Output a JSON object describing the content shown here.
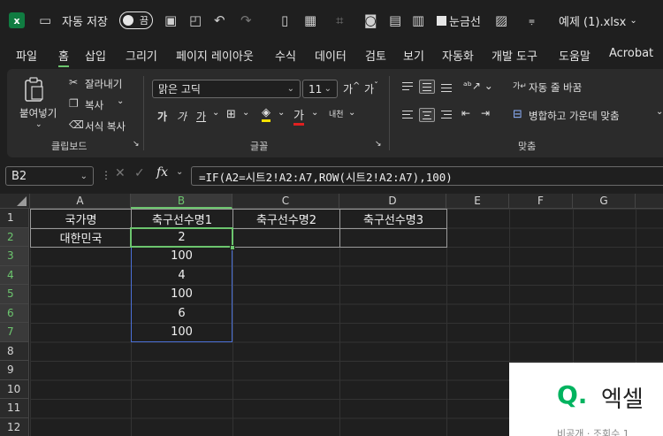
{
  "titlebar": {
    "autosave_label": "자동 저장",
    "toggle_state": "끔",
    "gridlines_label": "눈금선",
    "filename": "예제 (1).xlsx"
  },
  "menu": {
    "tabs": [
      "파일",
      "홈",
      "삽입",
      "그리기",
      "페이지 레이아웃",
      "수식",
      "데이터",
      "검토",
      "보기",
      "자동화",
      "개발 도구",
      "도움말",
      "Acrobat"
    ],
    "active": "홈"
  },
  "ribbon": {
    "clipboard": {
      "paste": "붙여넣기",
      "cut": "잘라내기",
      "copy": "복사",
      "format_painter": "서식 복사",
      "label": "클립보드"
    },
    "font": {
      "font_name": "맑은 고딕",
      "font_size": "11",
      "label": "글꼴"
    },
    "alignment": {
      "wrap_text": "자동 줄 바꿈",
      "merge_center": "병합하고 가운데 맞춤",
      "label": "맞춤"
    }
  },
  "formula_bar": {
    "name_box": "B2",
    "fx": "fx",
    "formula": "=IF(A2=시트2!A2:A7,ROW(시트2!A2:A7),100)"
  },
  "sheet": {
    "columns": [
      "A",
      "B",
      "C",
      "D",
      "E",
      "F",
      "G"
    ],
    "rows": [
      "1",
      "2",
      "3",
      "4",
      "5",
      "6",
      "7",
      "8",
      "9",
      "10",
      "11",
      "12"
    ],
    "cells": {
      "A1": "국가명",
      "B1": "축구선수명1",
      "C1": "축구선수명2",
      "D1": "축구선수명3",
      "A2": "대한민국",
      "B2": "2",
      "B3": "100",
      "B4": "4",
      "B5": "100",
      "B6": "6",
      "B7": "100"
    },
    "selected_cell": "B2",
    "selected_range": "B2:B7"
  },
  "overlay": {
    "q": "Q.",
    "title": "엑셀",
    "sub": "비공개 · 조회수 1"
  },
  "colors": {
    "accent": "#6cc56e",
    "excel_green": "#107c41",
    "selection_blue": "#4a6fd6"
  }
}
